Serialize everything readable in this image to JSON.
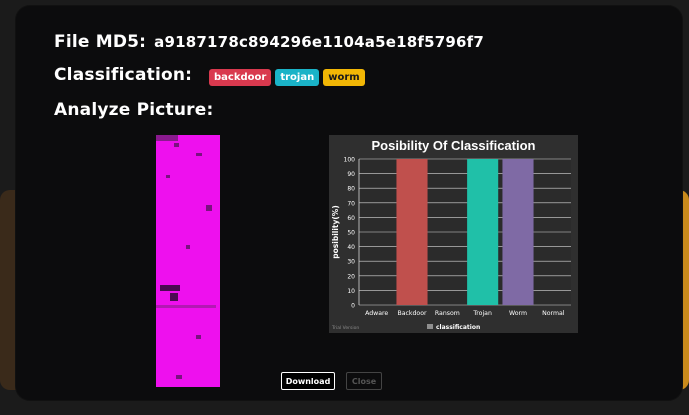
{
  "modal": {
    "md5_label": "File MD5:",
    "md5_value": "a9187178c894296e1104a5e18f5796f7",
    "classification_label": "Classification:",
    "badges": [
      {
        "label": "backdoor",
        "bg": "#d9394e",
        "fg": "#ffffff"
      },
      {
        "label": "trojan",
        "bg": "#1ab3c7",
        "fg": "#ffffff"
      },
      {
        "label": "worm",
        "bg": "#f2b705",
        "fg": "#1a1a1a"
      }
    ],
    "analyze_label": "Analyze Picture:",
    "download_label": "Download",
    "close_label": "Close"
  },
  "chart_data": {
    "type": "bar",
    "title": "Posibility Of Classification",
    "ylabel": "posibility(%)",
    "xlabel": "",
    "categories": [
      "Adware",
      "Backdoor",
      "Ransom",
      "Trojan",
      "Worm",
      "Normal"
    ],
    "series": [
      {
        "name": "classification",
        "values": [
          0,
          100,
          0,
          100,
          100,
          0
        ]
      }
    ],
    "bar_colors": [
      "#c0504d",
      "#c0504d",
      "#c0504d",
      "#20c0a8",
      "#7f6aa5",
      "#c0504d"
    ],
    "ylim": [
      0,
      100
    ],
    "yticks": [
      0,
      10,
      20,
      30,
      40,
      50,
      60,
      70,
      80,
      90,
      100
    ],
    "grid": true,
    "legend_position": "bottom",
    "watermark": "Trial Version"
  }
}
